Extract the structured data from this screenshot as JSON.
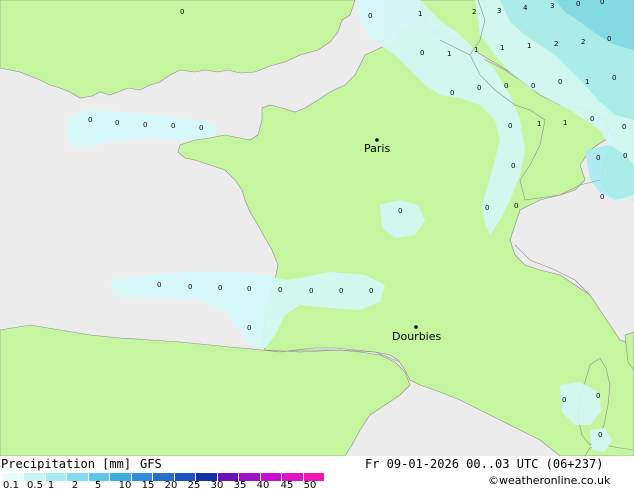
{
  "map": {
    "cities": [
      {
        "name": "Paris"
      },
      {
        "name": "Dourbies"
      }
    ],
    "grid_values": [
      "0",
      "0",
      "1",
      "2",
      "3",
      "4",
      "3",
      "0",
      "0",
      "0",
      "1",
      "1",
      "1",
      "1",
      "2",
      "2",
      "0",
      "0",
      "0",
      "0",
      "0",
      "0",
      "1",
      "0",
      "0",
      "0",
      "0",
      "0",
      "0",
      "0",
      "1",
      "1",
      "0",
      "0",
      "0",
      "0",
      "0",
      "0",
      "0",
      "0",
      "0",
      "0",
      "0",
      "0",
      "0",
      "0",
      "0",
      "0",
      "0",
      "0",
      "0",
      "0",
      "0",
      "0",
      "1",
      "1",
      "0",
      "0",
      "0"
    ]
  },
  "footer": {
    "title": "Precipitation [mm]",
    "model": "GFS",
    "datetime": "Fr 09-01-2026 00..03 UTC (06+237)",
    "credit": "©weatheronline.co.uk"
  },
  "legend": {
    "ticks": [
      "0.1",
      "0.5",
      "1",
      "2",
      "5",
      "10",
      "15",
      "20",
      "25",
      "30",
      "35",
      "40",
      "45",
      "50"
    ],
    "colors": [
      "#e8fdfd",
      "#c8f4f6",
      "#a6ecf2",
      "#83dcef",
      "#5ec6ea",
      "#3aaee3",
      "#2e8fd8",
      "#2670cc",
      "#1e50bf",
      "#1430a8",
      "#6a12b8",
      "#a010c8",
      "#c810d0",
      "#e010c8",
      "#f018b0"
    ]
  },
  "colors": {
    "land": "#c6f5a0",
    "sea": "#ececec",
    "rain_light": "#d4f8f8",
    "rain_mid": "#a8ecf0",
    "rain_high": "#7dd8ea",
    "border": "#8a8a8a"
  }
}
